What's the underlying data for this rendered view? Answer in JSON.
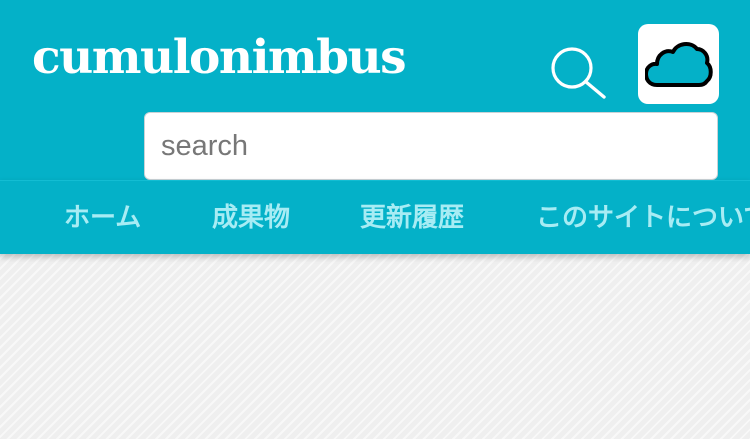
{
  "header": {
    "site_title": "cumulonimbus",
    "search_icon": "search-icon",
    "cloud_icon": "cloud-icon"
  },
  "search": {
    "placeholder": "search",
    "value": ""
  },
  "nav": {
    "items": [
      {
        "label": "ホーム"
      },
      {
        "label": "成果物"
      },
      {
        "label": "更新履歴"
      },
      {
        "label": "このサイトについて"
      }
    ]
  },
  "colors": {
    "header_bg": "#04b1c8",
    "nav_text": "#a7ecf4",
    "page_bg": "#efefef"
  }
}
